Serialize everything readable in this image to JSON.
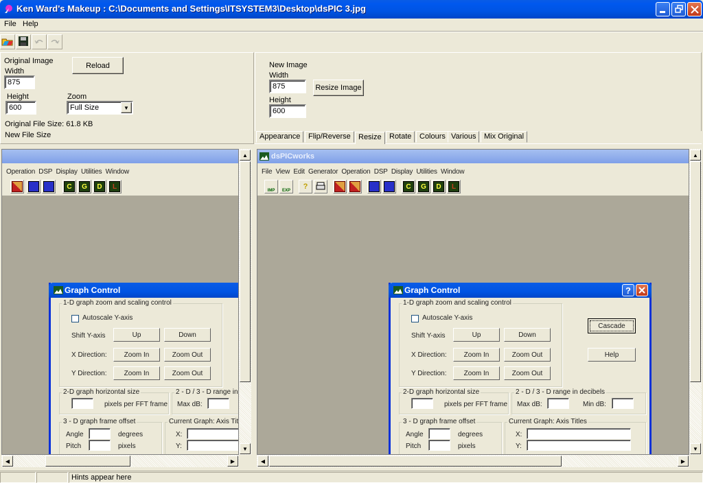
{
  "window": {
    "title": "Ken Ward's Makeup : C:\\Documents and Settings\\ITSYSTEM3\\Desktop\\dsPIC 3.jpg",
    "controls": {
      "minimize": "minimize-icon",
      "restore": "restore-icon",
      "close": "close-icon"
    }
  },
  "menu": [
    "File",
    "Help"
  ],
  "toolbar": [
    {
      "name": "open-icon"
    },
    {
      "name": "save-icon"
    },
    {
      "name": "undo-icon",
      "disabled": true
    },
    {
      "name": "redo-icon",
      "disabled": true
    }
  ],
  "original": {
    "heading": "Original Image",
    "reload_label": "Reload",
    "width_label": "Width",
    "width_value": "875",
    "height_label": "Height",
    "height_value": "600",
    "zoom_label": "Zoom",
    "zoom_value": "Full Size",
    "file_size_text": "Original File Size: 61.8 KB",
    "new_file_size_text": "New File Size"
  },
  "new_image": {
    "heading": "New Image",
    "width_label": "Width",
    "width_value": "875",
    "height_label": "Height",
    "height_value": "600",
    "resize_label": "Resize Image"
  },
  "tabs": [
    {
      "label": "Appearance",
      "active": false
    },
    {
      "label": "Flip/Reverse",
      "active": false
    },
    {
      "label": "Resize",
      "active": true
    },
    {
      "label": "Rotate",
      "active": false
    },
    {
      "label": "Colours",
      "active": false
    },
    {
      "label": "Various",
      "active": false
    },
    {
      "label": "Mix Original",
      "active": false
    }
  ],
  "left_view": {
    "menu": [
      "Operation",
      "DSP",
      "Display",
      "Utilities",
      "Window"
    ]
  },
  "right_view": {
    "app_title": "dsPICworks",
    "menu": [
      "File",
      "View",
      "Edit",
      "Generator",
      "Operation",
      "DSP",
      "Display",
      "Utilities",
      "Window"
    ],
    "toolbar_letters": [
      "C",
      "G",
      "D",
      "L"
    ],
    "toolbar_labels": [
      "IMP",
      "EXP"
    ]
  },
  "graph_control": {
    "title": "Graph Control",
    "group1_title": "1-D graph zoom and scaling control",
    "autoscale_label": "Autoscale Y-axis",
    "autoscale_checked": false,
    "shift_label": "Shift Y-axis",
    "up_label": "Up",
    "down_label": "Down",
    "x_dir_label": "X Direction:",
    "y_dir_label": "Y Direction:",
    "zoom_in_label": "Zoom In",
    "zoom_out_label": "Zoom Out",
    "cascade_label": "Cascade",
    "help_label": "Help",
    "group2_title": "2-D graph horizontal size",
    "pixels_fft_label": "pixels per FFT frame",
    "group3_title": "2 - D / 3 - D range in decibels",
    "group3_title_truncated": "2 - D / 3 - D range in d",
    "max_db_label": "Max dB:",
    "min_db_label": "Min dB:",
    "group4_title": "3 - D graph frame offset",
    "angle_label": "Angle",
    "degrees_label": "degrees",
    "pitch_label": "Pitch",
    "pixels_label": "pixels",
    "group5_title": "Current Graph: Axis Titles",
    "x_label": "X:",
    "y_label": "Y:"
  },
  "status": {
    "hint": "Hints appear here"
  }
}
